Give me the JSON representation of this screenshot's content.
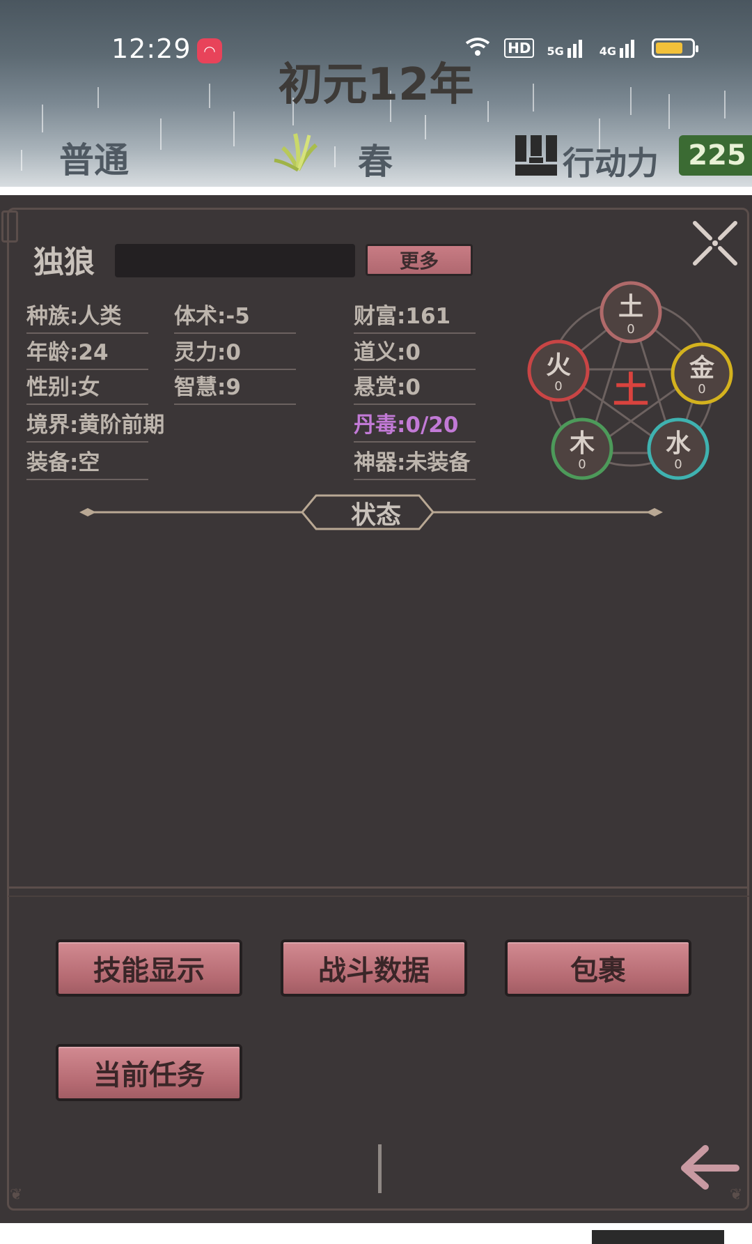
{
  "status_bar": {
    "time": "12:29",
    "network_labels": [
      "HD",
      "5G",
      "4G"
    ]
  },
  "header": {
    "year": "初元12年",
    "mode": "普通",
    "season": "春",
    "action_points_label": "行动力",
    "action_points_value": "225"
  },
  "character": {
    "name": "独狼",
    "more_button": "更多",
    "stats_col1": [
      "种族:人类",
      "年龄:24",
      "性别:女",
      "境界:黄阶前期",
      "装备:空"
    ],
    "stats_col2": [
      "体术:-5",
      "灵力:0",
      "智慧:9"
    ],
    "stats_col3": [
      "财富:161",
      "道义:0",
      "悬赏:0",
      "丹毒:0/20",
      "神器:未装备"
    ]
  },
  "wuxing": {
    "center": "土",
    "elements": [
      {
        "name": "土",
        "value": "0",
        "color": "#b06a6a"
      },
      {
        "name": "金",
        "value": "0",
        "color": "#d4b21e"
      },
      {
        "name": "水",
        "value": "0",
        "color": "#3fb2b0"
      },
      {
        "name": "木",
        "value": "0",
        "color": "#4d9a5a"
      },
      {
        "name": "火",
        "value": "0",
        "color": "#c94545"
      }
    ]
  },
  "status_section": {
    "title": "状态"
  },
  "actions": {
    "skills": "技能显示",
    "battle": "战斗数据",
    "bag": "包裹",
    "quest": "当前任务"
  },
  "colors": {
    "panel_bg": "#3b3637",
    "button_pink": "#c87c84",
    "ap_green": "#3b6b33",
    "poison_purple": "#c27ad6"
  }
}
